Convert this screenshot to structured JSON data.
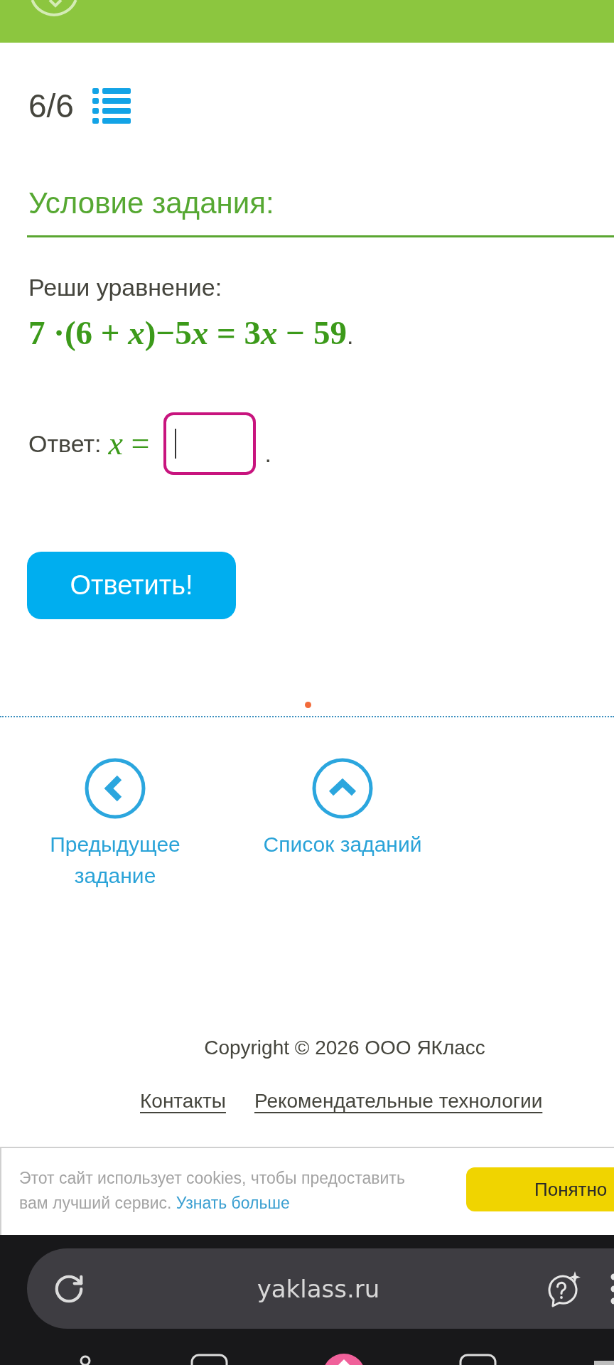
{
  "task_counter": "6/6",
  "section_title": "Условие задания:",
  "task": {
    "instruction": "Реши уравнение:",
    "equation": [
      {
        "kind": "text",
        "text": "7 ·(6 + "
      },
      {
        "kind": "variable",
        "text": "x"
      },
      {
        "kind": "text",
        "text": ")−5"
      },
      {
        "kind": "variable",
        "text": "x"
      },
      {
        "kind": "text",
        "text": " = 3"
      },
      {
        "kind": "variable",
        "text": "x"
      },
      {
        "kind": "text",
        "text": " − 59"
      }
    ],
    "equation_end": "."
  },
  "answer": {
    "label": "Ответ:",
    "variable": "*x* =",
    "field": {
      "focused": true
    },
    "end": "."
  },
  "submit_button": "Ответить!",
  "navigation": [
    {
      "kind": "previous",
      "label": "Предыдущее задание"
    },
    {
      "kind": "list",
      "label": "Список заданий"
    }
  ],
  "footer": {
    "copyright": "Copyright © 2026 ООО ЯКласс",
    "links": [
      "Контакты",
      "Рекомендательные технологии"
    ]
  },
  "cookie_banner": {
    "text": "Этот сайт использует cookies, чтобы предоставить вам лучший сервис.",
    "link": "Узнать больше",
    "button": "Понятно"
  },
  "browser": {
    "url": "yaklass.ru"
  }
}
